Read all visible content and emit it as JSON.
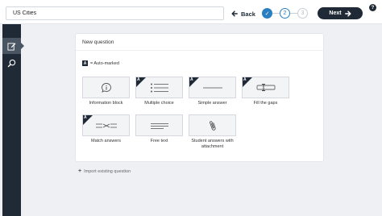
{
  "header": {
    "title_value": "US Cities",
    "back_label": "Back",
    "steps": [
      "✓",
      "2",
      "3"
    ],
    "next_label": "Next",
    "help_label": "?"
  },
  "panel": {
    "title": "New question",
    "legend_badge": "A",
    "legend_text": "= Auto-marked",
    "question_types": [
      {
        "label": "Information block",
        "icon": "info-icon",
        "auto_marked": false
      },
      {
        "label": "Multiple choice",
        "icon": "list-icon",
        "auto_marked": true
      },
      {
        "label": "Simple answer",
        "icon": "line-icon",
        "auto_marked": true
      },
      {
        "label": "Fill the gaps",
        "icon": "text-cursor-icon",
        "auto_marked": true
      },
      {
        "label": "Match answers",
        "icon": "match-icon",
        "auto_marked": true
      },
      {
        "label": "Free text",
        "icon": "lines-icon",
        "auto_marked": false
      },
      {
        "label": "Student answers with attachment",
        "icon": "paperclip-icon",
        "auto_marked": false
      }
    ],
    "import_label": "Import existing question"
  },
  "sidebar": {
    "items": [
      {
        "icon": "edit-icon",
        "active": true
      },
      {
        "icon": "search-icon",
        "active": false
      }
    ]
  },
  "colors": {
    "dark": "#1f2a36",
    "accent": "#2a7fc1",
    "background": "#eef0f3"
  }
}
